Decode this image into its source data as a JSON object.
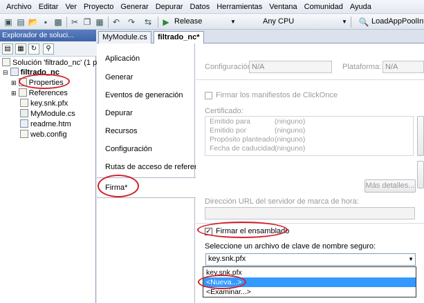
{
  "menu": [
    "Archivo",
    "Editar",
    "Ver",
    "Proyecto",
    "Generar",
    "Depurar",
    "Datos",
    "Herramientas",
    "Ventana",
    "Comunidad",
    "Ayuda"
  ],
  "toolbar": {
    "config": "Release",
    "platform": "Any CPU",
    "target": "LoadAppPoolInfo"
  },
  "solution_explorer": {
    "title": "Explorador de soluci...",
    "solution": "Solución 'filtrado_nc' (1 pro",
    "project": "filtrado_nc",
    "items": [
      "Properties",
      "References",
      "key.snk.pfx",
      "MyModule.cs",
      "readme.htm",
      "web.config"
    ]
  },
  "doc_tabs": [
    "MyModule.cs",
    "filtrado_nc*"
  ],
  "nav": {
    "items": [
      "Aplicación",
      "Generar",
      "Eventos de generación",
      "Depurar",
      "Recursos",
      "Configuración",
      "Rutas de acceso de referencia"
    ],
    "selected": "Firma*"
  },
  "signing": {
    "config_label": "Configuración:",
    "config_value": "N/A",
    "platform_label": "Plataforma:",
    "platform_value": "N/A",
    "clickonce_label": "Firmar los manifiestos de ClickOnce",
    "certificate_label": "Certificado:",
    "cert_rows": [
      {
        "key": "Emitido para",
        "value": "(ninguno)"
      },
      {
        "key": "Emitido por",
        "value": "(ninguno)"
      },
      {
        "key": "Propósito planteado",
        "value": "(ninguno)"
      },
      {
        "key": "Fecha de caducidad",
        "value": "(ninguno)"
      }
    ],
    "more_details": "Más detalles...",
    "timestamp_label": "Dirección URL del servidor de marca de hora:",
    "sign_assembly_label": "Firmar el ensamblado",
    "keyfile_label": "Seleccione un archivo de clave de nombre seguro:",
    "keyfile_value": "key.snk.pfx",
    "options": [
      "key.snk.pfx",
      "<Nueva...>",
      "<Examinar...>"
    ]
  },
  "colors": {
    "highlight": "#3399ff",
    "annotation": "#d21f2a",
    "title_bar": "#4a6fb3"
  }
}
